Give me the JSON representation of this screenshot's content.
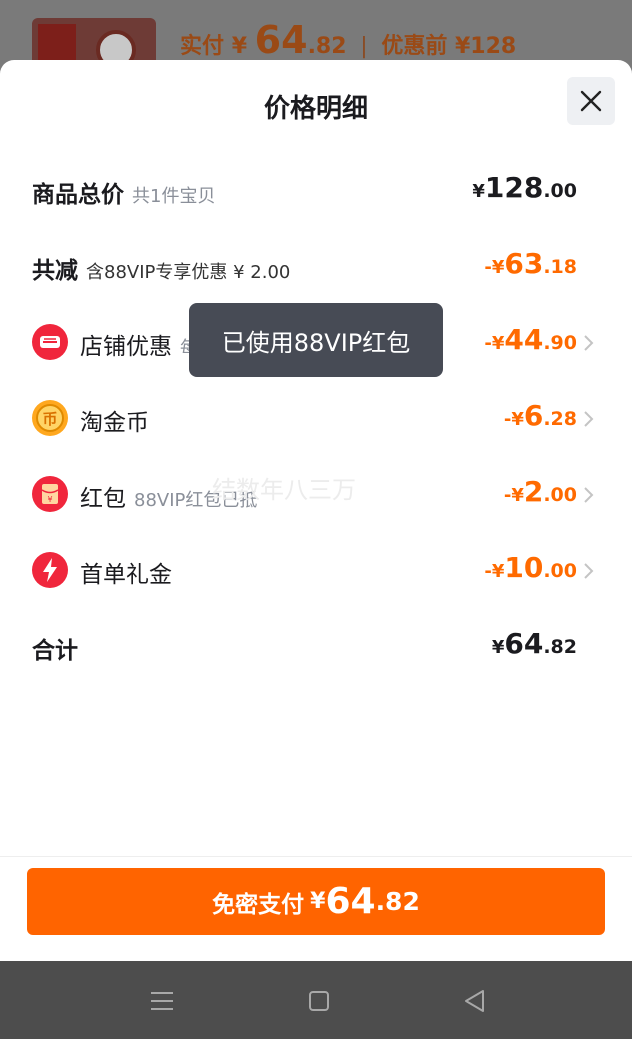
{
  "background": {
    "price_prefix": "实付",
    "price_yen": "¥",
    "price_int": "64",
    "price_dec": ".82",
    "original_label": "优惠前",
    "original_price": "¥128"
  },
  "sheet": {
    "title": "价格明细",
    "close_icon": "close-icon"
  },
  "rows": {
    "total": {
      "label": "商品总价",
      "sub": "共1件宝贝",
      "yen": "¥",
      "int": "128",
      "dec": ".00"
    },
    "discount": {
      "label": "共减",
      "sub": "含88VIP专享优惠 ¥ 2.00",
      "sign": "-",
      "yen": "¥",
      "int": "63",
      "dec": ".18"
    },
    "store": {
      "label": "店铺优惠",
      "sub": "每满",
      "sign": "-",
      "yen": "¥",
      "int": "44",
      "dec": ".90",
      "icon": "store-coupon-icon"
    },
    "coins": {
      "label": "淘金币",
      "sign": "-",
      "yen": "¥",
      "int": "6",
      "dec": ".28",
      "icon": "taojinbi-coin-icon"
    },
    "redpacket": {
      "label": "红包",
      "sub": "88VIP红包已抵",
      "sign": "-",
      "yen": "¥",
      "int": "2",
      "dec": ".00",
      "icon": "red-packet-icon"
    },
    "firstorder": {
      "label": "首单礼金",
      "sign": "-",
      "yen": "¥",
      "int": "10",
      "dec": ".00",
      "icon": "lightning-icon"
    },
    "sum": {
      "label": "合计",
      "yen": "¥",
      "int": "64",
      "dec": ".82"
    }
  },
  "toast": {
    "text": "已使用88VIP红包"
  },
  "watermark": {
    "text": "结数年八三万"
  },
  "pay_button": {
    "label": "免密支付",
    "yen": "¥",
    "int": "64",
    "dec": ".82"
  },
  "colors": {
    "accent": "#ff6400",
    "discount": "#ff6a00",
    "toast_bg": "#474b55"
  },
  "navbar": {
    "icons": [
      "menu-icon",
      "home-square-icon",
      "back-triangle-icon"
    ]
  }
}
